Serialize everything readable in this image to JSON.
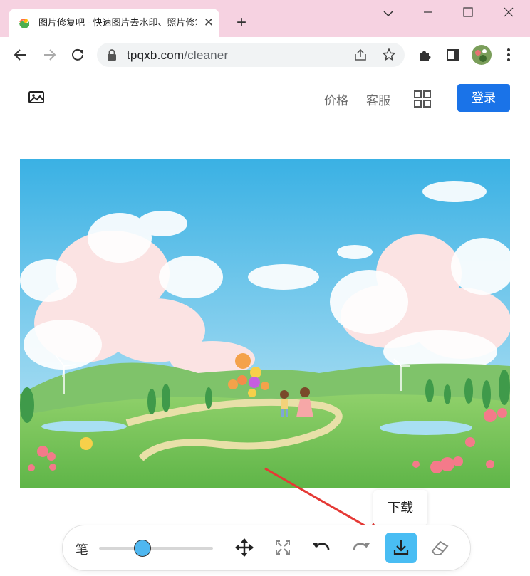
{
  "browser": {
    "tab": {
      "title": "图片修复吧 - 快速图片去水印、照片修复",
      "close_icon": "close-icon",
      "favicon": "app-favicon"
    },
    "new_tab_label": "+",
    "window_controls": [
      "chevron-down-icon",
      "minimize-icon",
      "maximize-icon",
      "close-icon"
    ],
    "url": {
      "host": "tpqxb.com",
      "path": "/cleaner"
    },
    "toolbar_icons": [
      "back-icon",
      "forward-icon",
      "reload-icon",
      "lock-icon",
      "share-icon",
      "star-icon",
      "extensions-icon",
      "sidepanel-icon",
      "profile-avatar",
      "more-icon"
    ]
  },
  "header": {
    "logo_icon": "image-icon",
    "nav": [
      "价格",
      "客服"
    ],
    "apps_icon": "grid-icon",
    "login_label": "登录"
  },
  "tooltip": {
    "text": "下载"
  },
  "editbar": {
    "pen_label": "笔",
    "brush_size_fraction": 0.38,
    "tools": [
      "move-icon",
      "fullscreen-icon",
      "undo-icon",
      "redo-icon",
      "download-icon",
      "eraser-icon"
    ]
  },
  "colors": {
    "titlebar": "#f6d2e1",
    "accent": "#1a73e8",
    "download_button": "#49bdf3",
    "annotation_arrow": "#e53935"
  }
}
